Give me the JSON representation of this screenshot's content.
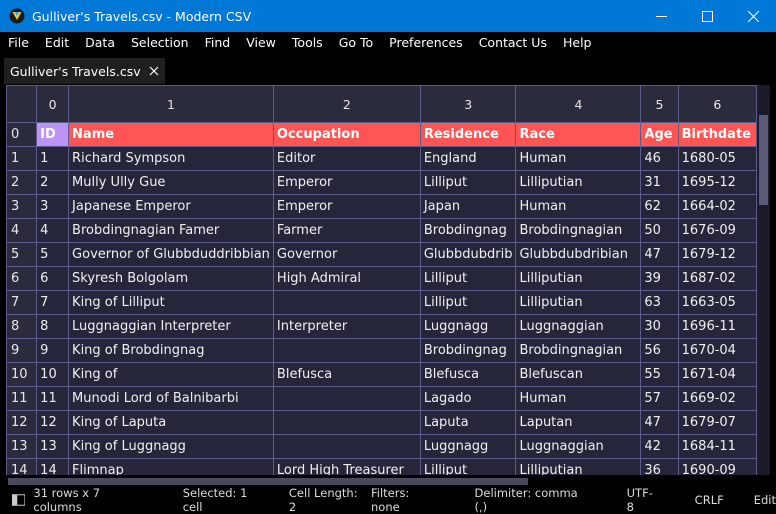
{
  "window": {
    "title": "Gulliver's Travels.csv - Modern CSV"
  },
  "menu": [
    "File",
    "Edit",
    "Data",
    "Selection",
    "Find",
    "View",
    "Tools",
    "Go To",
    "Preferences",
    "Contact Us",
    "Help"
  ],
  "tab": {
    "label": "Gulliver's Travels.csv"
  },
  "grid": {
    "columns": [
      "0",
      "1",
      "2",
      "3",
      "4",
      "5",
      "6"
    ],
    "rows": [
      [
        "0",
        [
          "ID",
          "Name",
          "Occupation",
          "Residence",
          "Race",
          "Age",
          "Birthdate"
        ]
      ],
      [
        "1",
        [
          "1",
          "Richard Sympson",
          "Editor",
          "England",
          "Human",
          "46",
          "1680-05"
        ]
      ],
      [
        "2",
        [
          "2",
          "Mully Ully Gue",
          "Emperor",
          "Lilliput",
          "Lilliputian",
          "31",
          "1695-12"
        ]
      ],
      [
        "3",
        [
          "3",
          "Japanese Emperor",
          "Emperor",
          "Japan",
          "Human",
          "62",
          "1664-02"
        ]
      ],
      [
        "4",
        [
          "4",
          "Brobdingnagian Famer",
          "Farmer",
          "Brobdingnag",
          "Brobdingnagian",
          "50",
          "1676-09"
        ]
      ],
      [
        "5",
        [
          "5",
          "Governor of Glubbduddribbian",
          "Governor",
          "Glubbdubdrib",
          "Glubbdubdribian",
          "47",
          "1679-12"
        ]
      ],
      [
        "6",
        [
          "6",
          "Skyresh Bolgolam",
          "High Admiral",
          "Lilliput",
          "Lilliputian",
          "39",
          "1687-02"
        ]
      ],
      [
        "7",
        [
          "7",
          "King of  Lilliput",
          "",
          "Lilliput",
          "Lilliputian",
          "63",
          "1663-05"
        ]
      ],
      [
        "8",
        [
          "8",
          "Luggnaggian Interpreter",
          "Interpreter",
          "Luggnagg",
          "Luggnaggian",
          "30",
          "1696-11"
        ]
      ],
      [
        "9",
        [
          "9",
          "King of  Brobdingnag",
          "",
          "Brobdingnag",
          "Brobdingnagian",
          "56",
          "1670-04"
        ]
      ],
      [
        "10",
        [
          "10",
          "King of",
          "Blefusca",
          "Blefusca",
          "Blefuscan",
          "55",
          "1671-04"
        ]
      ],
      [
        "11",
        [
          "11",
          "Munodi Lord of Balnibarbi",
          "",
          "Lagado",
          "Human",
          "57",
          "1669-02"
        ]
      ],
      [
        "12",
        [
          "12",
          "King of  Laputa",
          "",
          "Laputa",
          "Laputan",
          "47",
          "1679-07"
        ]
      ],
      [
        "13",
        [
          "13",
          "King of  Luggnagg",
          "",
          "Luggnagg",
          "Luggnaggian",
          "42",
          "1684-11"
        ]
      ],
      [
        "14",
        [
          "14",
          "Flimnap",
          "Lord High Treasurer",
          "Lilliput",
          "Lilliputian",
          "36",
          "1690-09"
        ]
      ]
    ]
  },
  "status": {
    "rows_cols": "31 rows x 7 columns",
    "selected": "Selected: 1 cell",
    "cell_length": "Cell Length: 2",
    "filters": "Filters: none",
    "delimiter": "Delimiter: comma (,)",
    "encoding": "UTF-8",
    "line_ending": "CRLF",
    "mode": "Edit"
  }
}
